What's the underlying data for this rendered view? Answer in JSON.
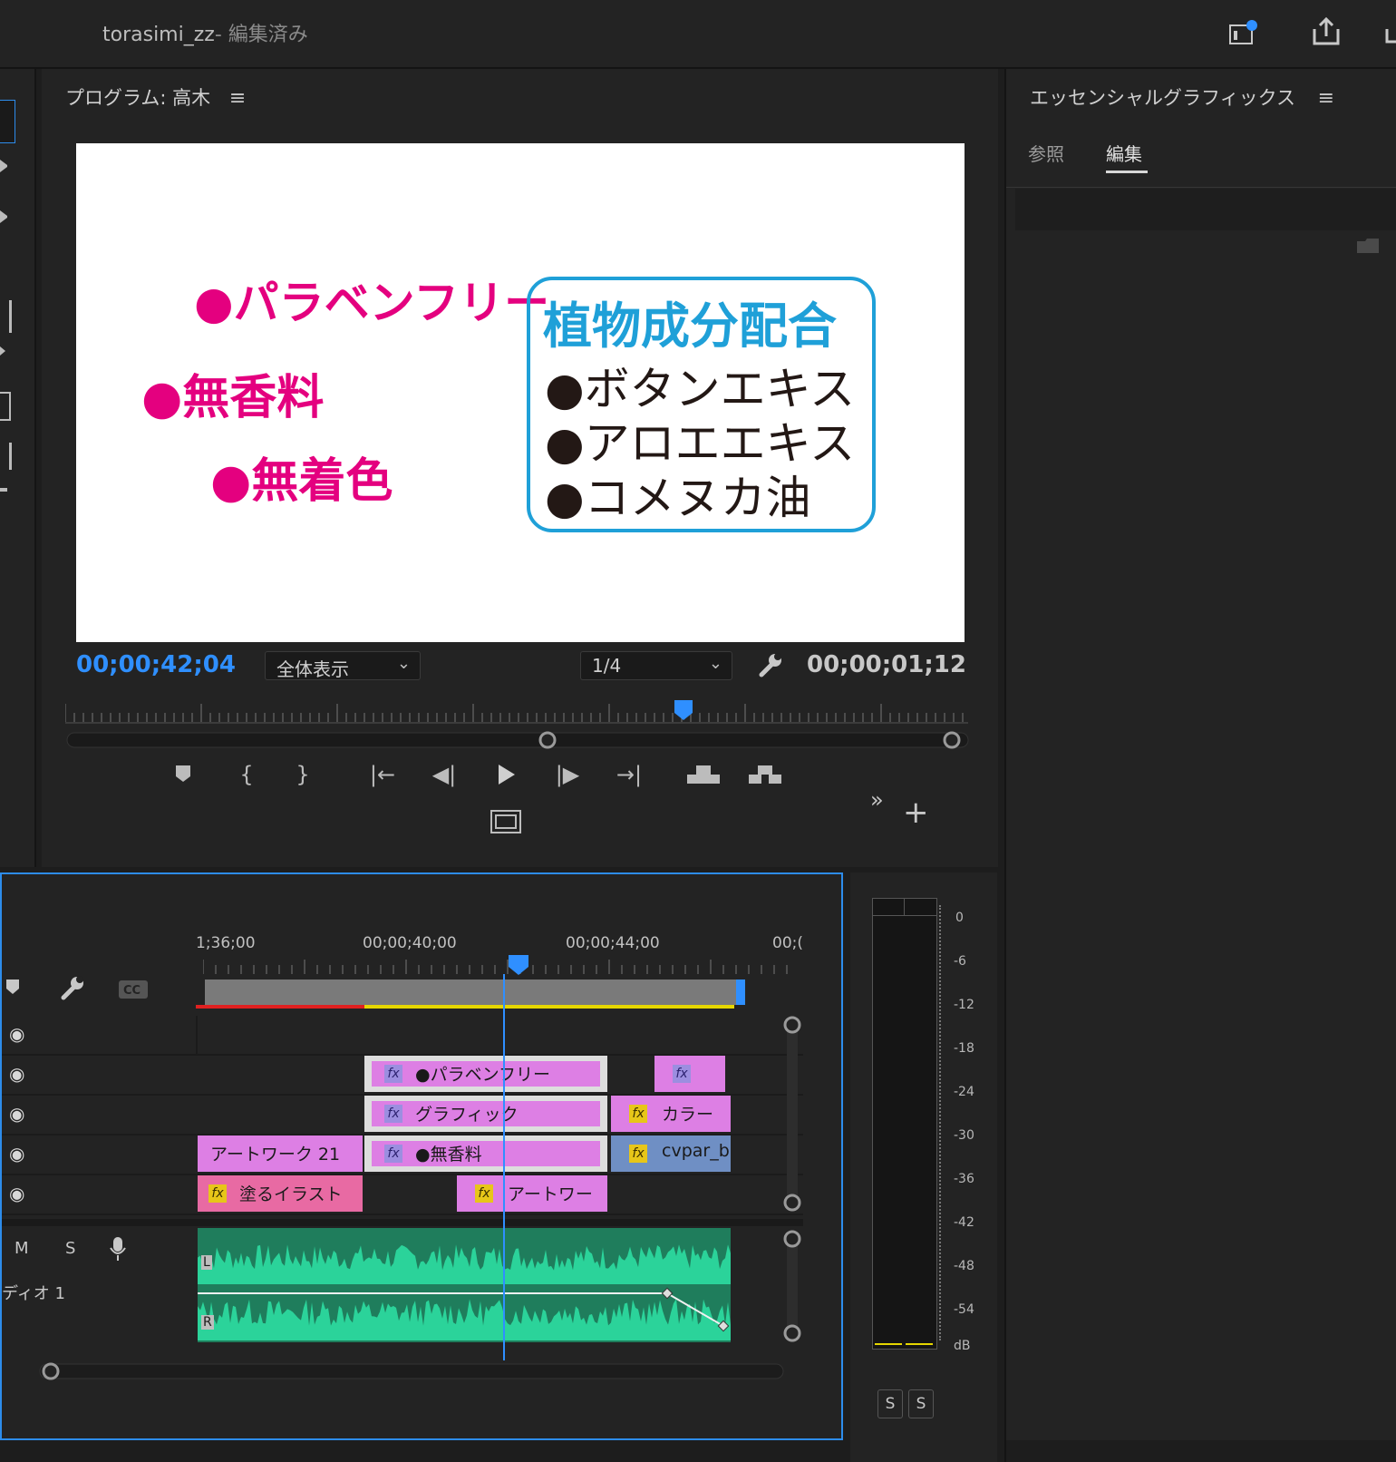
{
  "window": {
    "doc_name": "torasimi_zz",
    "doc_state": "- 編集済み"
  },
  "program": {
    "title": "プログラム: 高木",
    "timecode_current": "00;00;42;04",
    "zoom": "全体表示",
    "resolution": "1/4",
    "timecode_duration": "00;00;01;12"
  },
  "frame": {
    "line1": "●パラベンフリー",
    "line2": "●無香料",
    "line3": "●無着色",
    "box_title": "植物成分配合",
    "box_items": [
      "●ボタンエキス",
      "●アロエエキス",
      "●コメヌカ油"
    ],
    "colors": {
      "pink": "#e4007f",
      "blue": "#1fa0d8"
    }
  },
  "essential_graphics": {
    "title": "エッセンシャルグラフィックス",
    "tabs": [
      {
        "label": "参照",
        "active": false
      },
      {
        "label": "編集",
        "active": true
      }
    ]
  },
  "timeline": {
    "ruler": [
      "1;36;00",
      "00;00;40;00",
      "00;00;44;00",
      "00;("
    ],
    "clips": {
      "v4_a": "●パラベンフリー",
      "v3_a": "グラフィック",
      "v3_b": "カラー",
      "v2_a": "アートワーク 21",
      "v2_b": "●無香料",
      "v2_c": "cvpar_b.",
      "v1_a": "塗るイラスト",
      "v1_b": "アートワー"
    },
    "audio": {
      "mute": "M",
      "solo": "S",
      "track_name": "ディオ 1",
      "left": "L",
      "right": "R"
    }
  },
  "meter": {
    "db_labels": [
      "0",
      "-6",
      "-12",
      "-18",
      "-24",
      "-30",
      "-36",
      "-42",
      "-48",
      "-54",
      "dB"
    ],
    "solo": [
      "S",
      "S"
    ]
  }
}
